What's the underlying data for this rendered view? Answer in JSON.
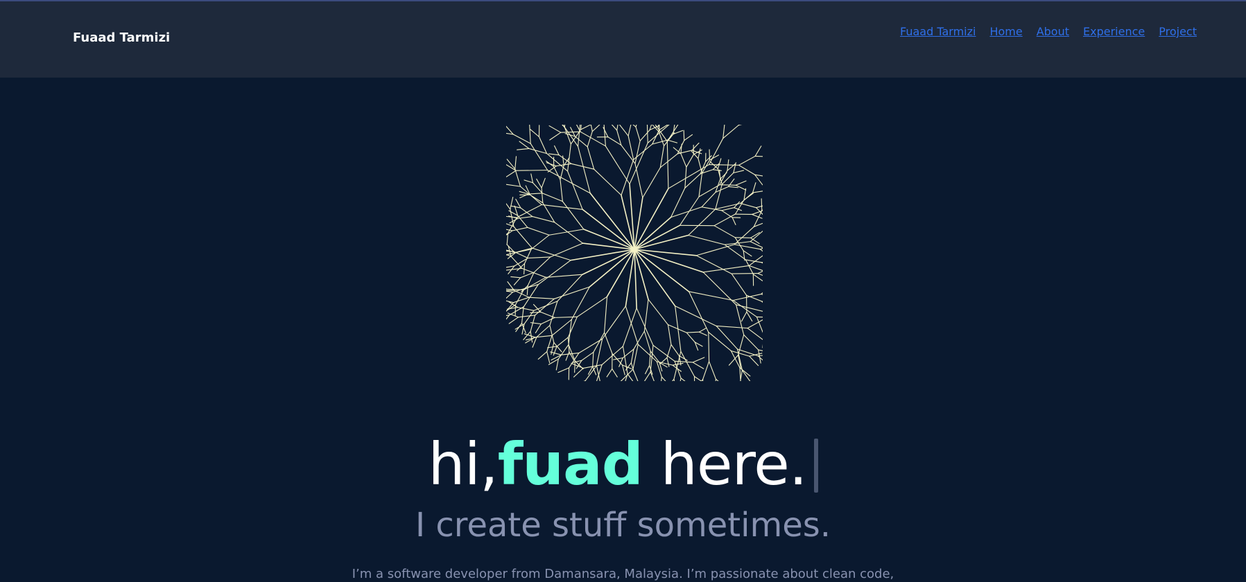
{
  "header": {
    "brand": "Fuaad Tarmizi",
    "nav": [
      "Fuaad Tarmizi",
      "Home",
      "About",
      "Experience",
      "Project"
    ]
  },
  "hero": {
    "greeting": "hi,",
    "name": "fuad",
    "suffix": " here.",
    "subtitle": "I create stuff sometimes.",
    "description": "I’m a software developer from Damansara, Malaysia. I’m passionate about clean code,"
  },
  "colors": {
    "background": "#0a192f",
    "header": "#1e293b",
    "accent": "#64ffda",
    "tree": "#f5f2c6",
    "link": "#2f6fe8",
    "muted": "#8892b0"
  }
}
